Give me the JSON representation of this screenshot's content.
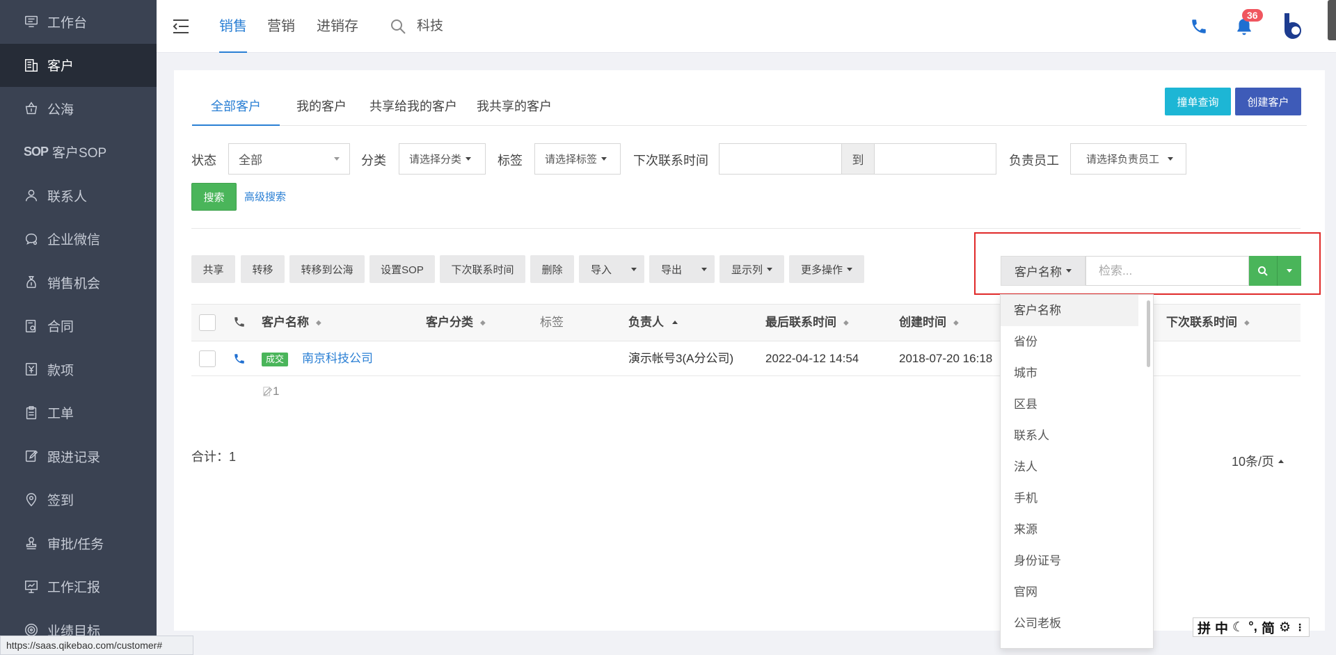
{
  "sidebar": {
    "items": [
      {
        "label": "工作台",
        "icon": "monitor-icon"
      },
      {
        "label": "客户",
        "icon": "building-icon"
      },
      {
        "label": "公海",
        "icon": "basket-icon"
      },
      {
        "label": "客户SOP",
        "icon": "sop-icon"
      },
      {
        "label": "联系人",
        "icon": "person-icon"
      },
      {
        "label": "企业微信",
        "icon": "wechat-icon"
      },
      {
        "label": "销售机会",
        "icon": "moneybag-icon"
      },
      {
        "label": "合同",
        "icon": "contract-icon"
      },
      {
        "label": "款项",
        "icon": "yen-icon"
      },
      {
        "label": "工单",
        "icon": "clipboard-icon"
      },
      {
        "label": "跟进记录",
        "icon": "edit-icon"
      },
      {
        "label": "签到",
        "icon": "location-icon"
      },
      {
        "label": "审批/任务",
        "icon": "stamp-icon"
      },
      {
        "label": "工作汇报",
        "icon": "presentation-icon"
      },
      {
        "label": "业绩目标",
        "icon": "target-icon"
      }
    ],
    "active_index": 1,
    "sop_glyph": "SOP"
  },
  "topbar": {
    "tabs": [
      "销售",
      "营销",
      "进销存"
    ],
    "search_text": "科技",
    "notification_count": "36"
  },
  "subtabs": [
    "全部客户",
    "我的客户",
    "共享给我的客户",
    "我共享的客户"
  ],
  "header_buttons": {
    "collide": "撞单查询",
    "create": "创建客户"
  },
  "filters": {
    "status_label": "状态",
    "status_value": "全部",
    "category_label": "分类",
    "category_placeholder": "请选择分类",
    "tag_label": "标签",
    "tag_placeholder": "请选择标签",
    "next_contact_label": "下次联系时间",
    "to_label": "到",
    "owner_label": "负责员工",
    "owner_placeholder": "请选择负责员工",
    "search_button": "搜索",
    "advanced_search": "高级搜索"
  },
  "actions": {
    "share": "共享",
    "transfer": "转移",
    "to_pool": "转移到公海",
    "set_sop": "设置SOP",
    "next_contact": "下次联系时间",
    "delete": "删除",
    "import": "导入",
    "export": "导出",
    "columns": "显示列",
    "more": "更多操作"
  },
  "search": {
    "field": "客户名称",
    "placeholder": "检索..."
  },
  "table": {
    "headers": {
      "name": "客户名称",
      "category": "客户分类",
      "tag": "标签",
      "owner": "负责人",
      "last_contact": "最后联系时间",
      "created": "创建时间",
      "next_contact": "下次联系时间"
    },
    "rows": [
      {
        "status": "成交",
        "name": "南京科技公司",
        "owner": "演示帐号3(A分公司)",
        "last_contact": "2022-04-12 14:54",
        "created": "2018-07-20 16:18"
      }
    ],
    "edit_count": "1"
  },
  "footer": {
    "total": "合计：1",
    "per_page": "10条/页"
  },
  "dropdown": {
    "items": [
      "客户名称",
      "省份",
      "城市",
      "区县",
      "联系人",
      "法人",
      "手机",
      "来源",
      "身份证号",
      "官网",
      "公司老板"
    ]
  },
  "status_url": "https://saas.qikebao.com/customer#",
  "ime": {
    "chars": [
      "拼",
      "中",
      "简"
    ]
  },
  "colors": {
    "sidebar_bg": "#3a4252",
    "accent_blue": "#2a7fd4",
    "green": "#4ab55a",
    "cyan": "#1db6d5",
    "indigo": "#3e5bb8",
    "highlight_red": "#e02929"
  }
}
